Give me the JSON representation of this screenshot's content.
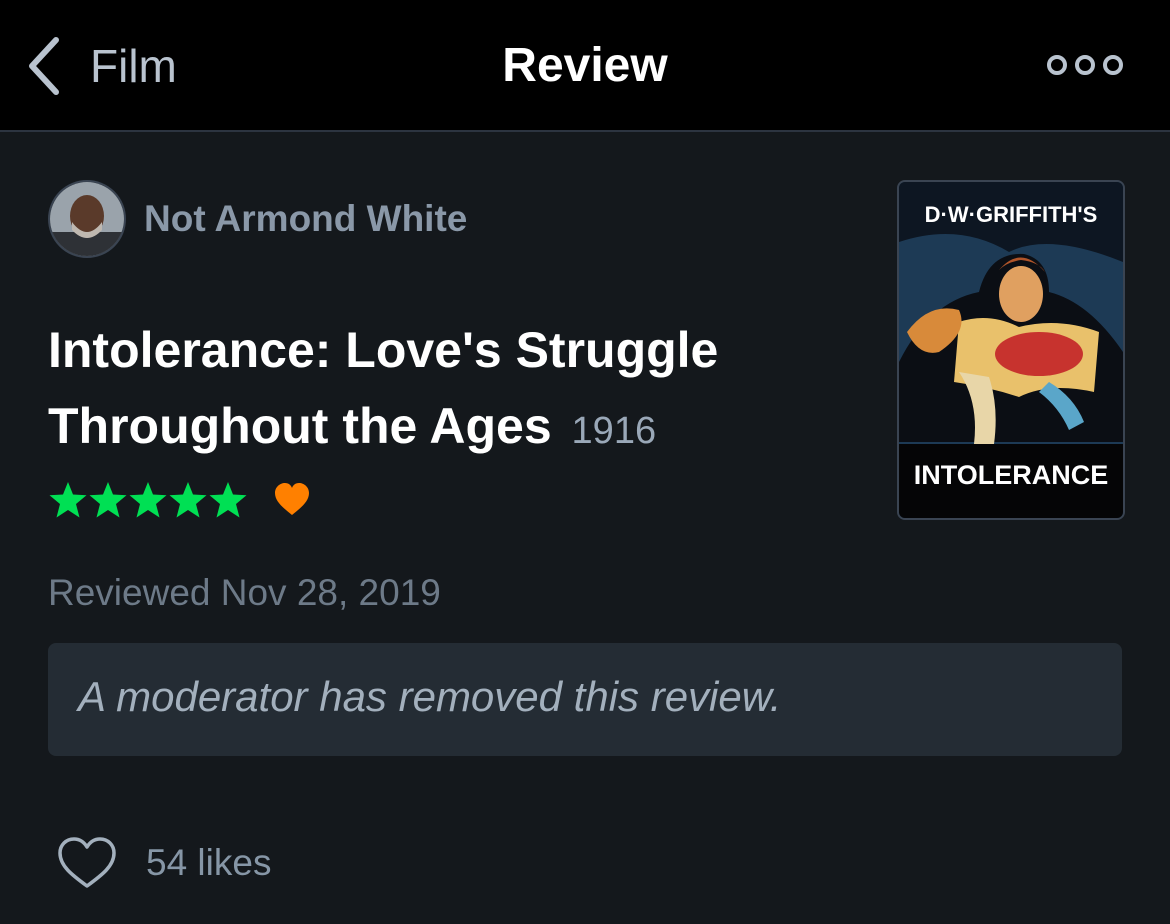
{
  "nav": {
    "back_label": "Film",
    "title": "Review"
  },
  "review": {
    "author": "Not Armond White",
    "film_title": "Intolerance: Love's Struggle Throughout the Ages",
    "film_year": "1916",
    "rating_stars": 5,
    "liked": true,
    "date": "Reviewed Nov 28, 2019",
    "body": "A moderator has removed this review.",
    "likes": "54 likes"
  },
  "poster": {
    "top_text": "D·W·GRIFFITH'S",
    "bottom_text": "INTOLERANCE"
  },
  "icons": {
    "back": "chevron-left-icon",
    "more": "more-dots-icon",
    "star": "star-icon",
    "heart": "heart-icon",
    "like": "heart-outline-icon"
  },
  "colors": {
    "background": "#14181c",
    "nav_background": "#000000",
    "star_green": "#00e054",
    "heart_orange": "#ff8000",
    "author_gray": "#8a98a8",
    "removed_box": "#242c34"
  }
}
